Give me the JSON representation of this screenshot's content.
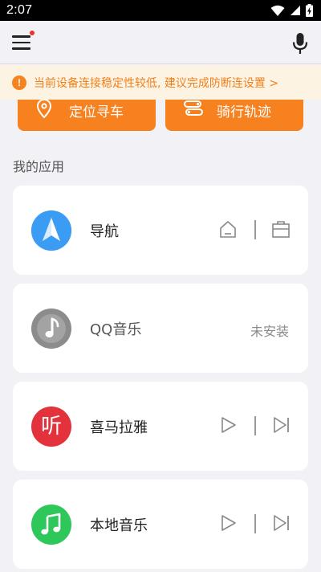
{
  "status_bar": {
    "time": "2:07",
    "icons": [
      "wifi-icon",
      "cell-signal-icon",
      "battery-charging-icon"
    ]
  },
  "app_bar": {
    "menu_icon": "hamburger-menu-icon",
    "has_notification_dot": true,
    "mic_icon": "microphone-icon"
  },
  "banner": {
    "icon": "warning-icon",
    "icon_glyph": "!",
    "text": "当前设备连接稳定性较低, 建议完成防断连设置 >",
    "color": "#f0801c",
    "background": "#fdf3e3"
  },
  "actions": [
    {
      "label": "定位寻车",
      "icon": "location-pin-icon"
    },
    {
      "label": "骑行轨迹",
      "icon": "route-icon"
    }
  ],
  "section_title": "我的应用",
  "apps": [
    {
      "name": "导航",
      "icon": "navigation-arrow-icon",
      "controls": [
        "home-icon",
        "briefcase-icon"
      ]
    },
    {
      "name": "QQ音乐",
      "icon": "music-note-icon",
      "status": "未安装"
    },
    {
      "name": "喜马拉雅",
      "icon": "ximalaya-ting-icon",
      "icon_glyph": "听",
      "controls": [
        "play-icon",
        "skip-next-icon"
      ]
    },
    {
      "name": "本地音乐",
      "icon": "local-music-icon",
      "controls": [
        "play-icon",
        "skip-next-icon"
      ]
    }
  ],
  "colors": {
    "accent": "#f7801f",
    "background": "#f2f2f6",
    "card": "#ffffff"
  }
}
